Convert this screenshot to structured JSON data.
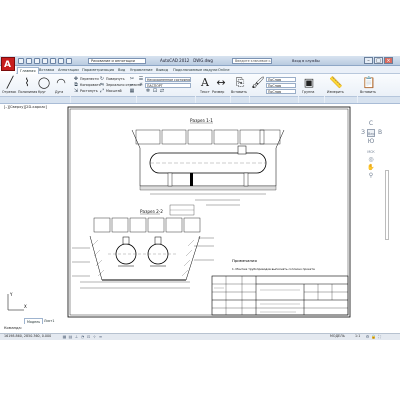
{
  "app": {
    "logo": "A",
    "workspace": "Рисование и аннотации",
    "title": "AutoCAD 2012",
    "file": "DWG.dwg",
    "search_placeholder": "Введите ключевое слово/фразу",
    "signin": "Вход в службы",
    "win_min": "–",
    "win_max": "□",
    "win_close": "×"
  },
  "tabs": [
    "Главная",
    "Вставка",
    "Аннотации",
    "Параметризация",
    "Вид",
    "Управление",
    "Вывод",
    "Подключаемые модули",
    "Online"
  ],
  "ribbon": {
    "groups": {
      "group": "Группа"
    },
    "draw": {
      "line": "Отрезок",
      "polyline": "Полилиния",
      "circle": "Круг",
      "arc": "Дуга"
    },
    "modify": {
      "move": "Перенести",
      "copy": "Копировать",
      "stretch": "Растянуть",
      "rotate": "Повернуть",
      "mirror": "Зеркально отразить",
      "scale": "Масштаб"
    },
    "layers": {
      "state": "Несохраненное состояние слоя",
      "current": "ПАСПОРТ"
    },
    "annotation": {
      "text": "Текст",
      "dimension": "Размер"
    },
    "block": {
      "insert": "Вставить"
    },
    "properties": {
      "match": "Копирование свойств",
      "bylayer": "ПоСлою"
    },
    "utilities": {
      "measure": "Измерить"
    },
    "clipboard": {
      "paste": "Вставить"
    }
  },
  "viewport": {
    "label": "[–][Сверху][2D-каркас]",
    "compass": {
      "n": "С",
      "w": "З",
      "e": "В",
      "s": "Ю",
      "top": "Вер",
      "wcs": "МСК"
    },
    "ucs": {
      "x": "X",
      "y": "Y"
    }
  },
  "drawing": {
    "section_11": "Разрез 1-1",
    "section_22": "Разрез 2-2",
    "notes_title": "Примечания",
    "note_1": "1. Монтаж трубопроводов выполнять согласно проекта"
  },
  "layout_tabs": [
    "Модель",
    "Лист1"
  ],
  "command": {
    "line1": "Команда:",
    "line2": "Команда:"
  },
  "status": {
    "coords": "16198.860, 2850.360, 0.000",
    "model": "МОДЕЛЬ",
    "scale": "1:1",
    "workspace": "Рисование и аннотации"
  },
  "colors": {
    "accent": "#3c6aa8",
    "logo": "#c81e1e",
    "ribbon": "#e6edf6"
  }
}
